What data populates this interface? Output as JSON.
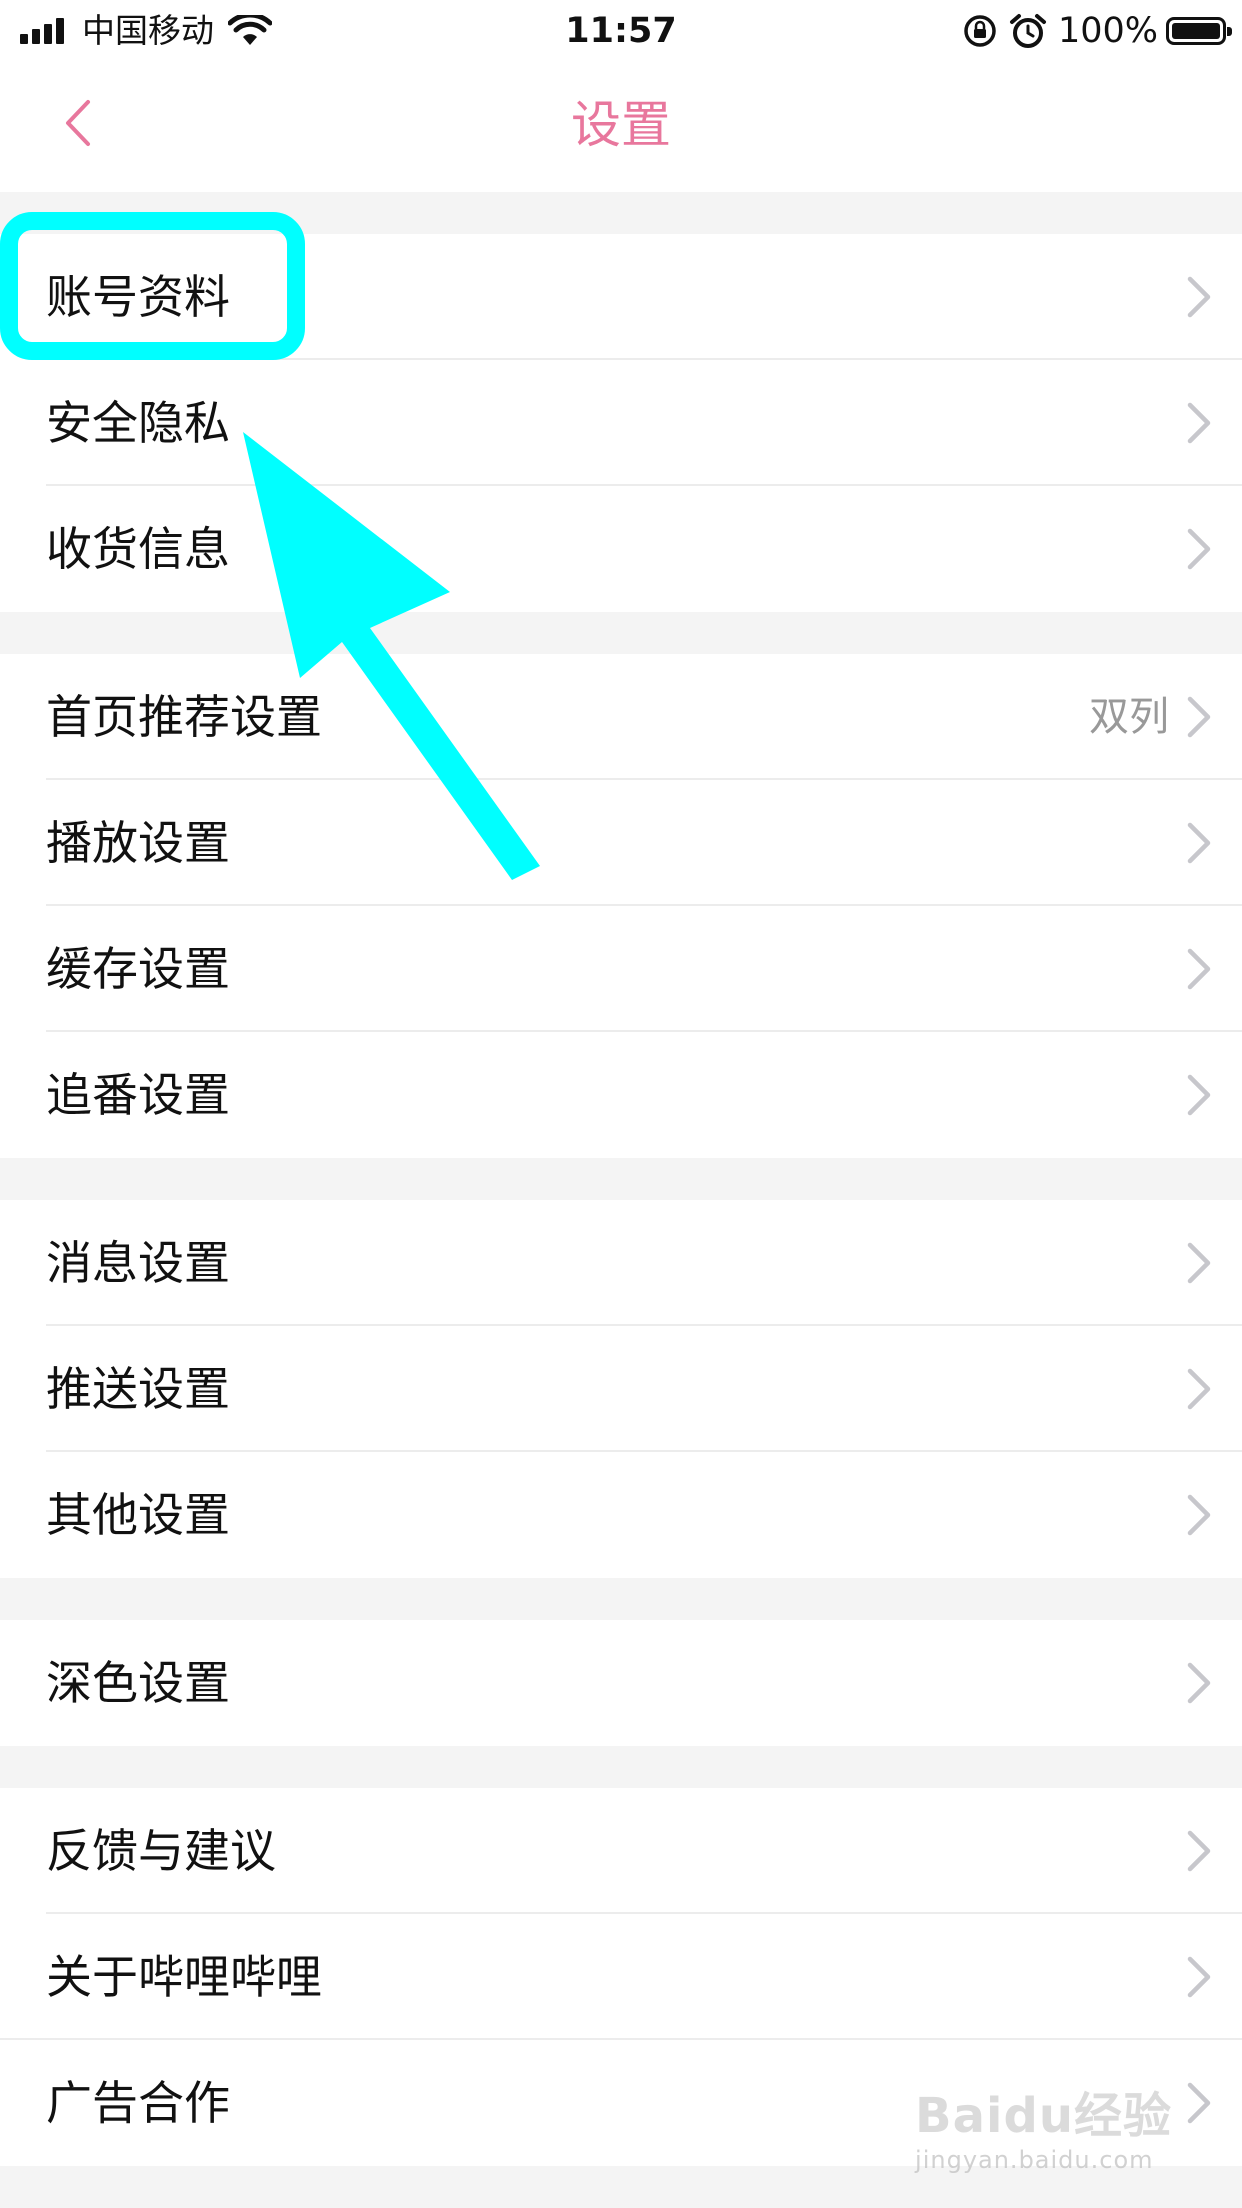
{
  "status_bar": {
    "carrier": "中国移动",
    "time": "11:57",
    "battery": "100%",
    "icons": [
      "signal-icon",
      "wifi-icon",
      "rotation-lock-icon",
      "alarm-icon",
      "battery-icon"
    ]
  },
  "header": {
    "title": "设置",
    "back_icon": "chevron-left-icon"
  },
  "groups": [
    {
      "items": [
        {
          "label": "账号资料"
        },
        {
          "label": "安全隐私"
        },
        {
          "label": "收货信息"
        }
      ]
    },
    {
      "items": [
        {
          "label": "首页推荐设置",
          "value": "双列"
        },
        {
          "label": "播放设置"
        },
        {
          "label": "缓存设置"
        },
        {
          "label": "追番设置"
        }
      ]
    },
    {
      "items": [
        {
          "label": "消息设置"
        },
        {
          "label": "推送设置"
        },
        {
          "label": "其他设置"
        }
      ]
    },
    {
      "items": [
        {
          "label": "深色设置"
        }
      ]
    },
    {
      "items": [
        {
          "label": "反馈与建议"
        },
        {
          "label": "关于哔哩哔哩"
        },
        {
          "label": "广告合作"
        }
      ]
    }
  ],
  "watermark": {
    "brand": "Baidu经验",
    "url": "jingyan.baidu.com"
  },
  "colors": {
    "accent": "#e8779d",
    "annotation": "#00ffff",
    "background": "#f4f4f4",
    "chevron": "#c7c7cc"
  }
}
